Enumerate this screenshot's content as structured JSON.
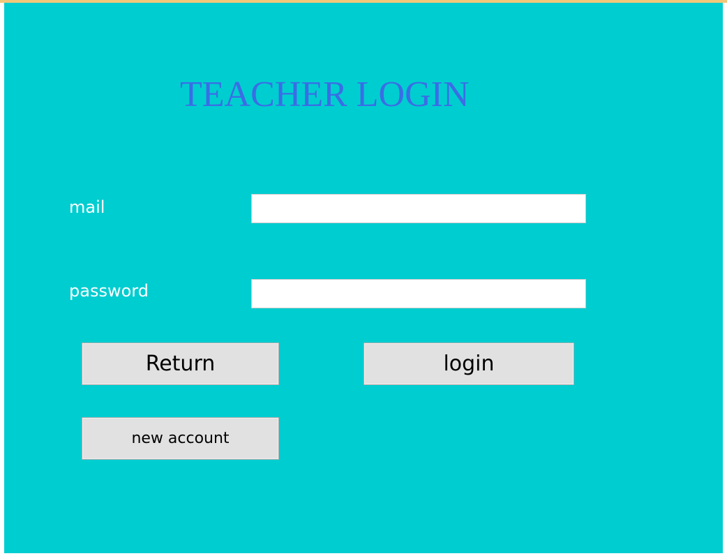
{
  "window": {
    "title_text": "TEACHER LOGIN",
    "background_color": "#00cdd0",
    "title_color": "#3a6de6"
  },
  "form": {
    "mail_label": "mail",
    "mail_value": "",
    "password_label": "password",
    "password_value": ""
  },
  "buttons": {
    "return_label": "Return",
    "login_label": "login",
    "new_account_label": "new account"
  }
}
